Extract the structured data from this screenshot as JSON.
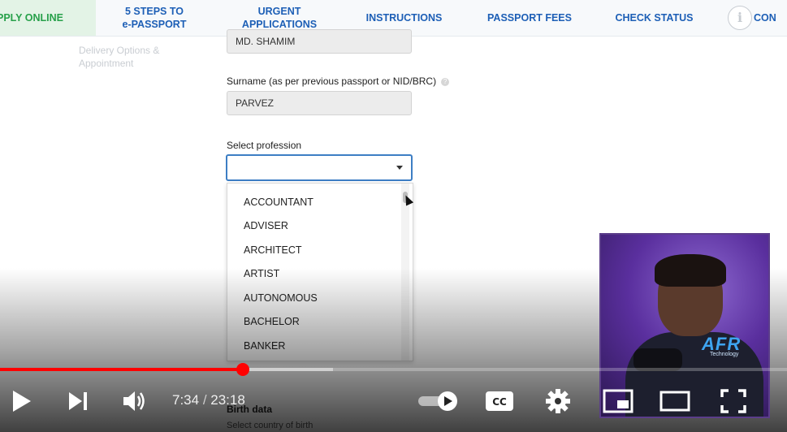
{
  "nav": {
    "apply_online": "PPLY ONLINE",
    "five_steps_line1": "5 STEPS TO",
    "five_steps_line2": "e-PASSPORT",
    "urgent_line1": "URGENT",
    "urgent_line2": "APPLICATIONS",
    "instructions": "INSTRUCTIONS",
    "passport_fees": "PASSPORT FEES",
    "check_status": "CHECK STATUS",
    "info_icon": "info-icon",
    "contact_partial": "CON"
  },
  "sidebar": {
    "step_label": "Delivery Options & Appointment"
  },
  "form": {
    "given_name_value": "MD. SHAMIM",
    "surname_label": "Surname (as per previous passport or NID/BRC)",
    "surname_value": "PARVEZ",
    "profession_label": "Select profession",
    "profession_value": "",
    "profession_options": [
      "ACCOUNTANT",
      "ADVISER",
      "ARCHITECT",
      "ARTIST",
      "AUTONOMOUS",
      "BACHELOR",
      "BANKER"
    ],
    "birth_label": "Birth data",
    "birth_sub": "Select country of birth"
  },
  "player": {
    "current_time": "7:34",
    "separator": " / ",
    "duration": "23:18",
    "progress_fraction": 0.309,
    "buffered_fraction": 0.423,
    "accent_color": "#ff0000",
    "autoplay_on": true,
    "icons": [
      "play-icon",
      "next-icon",
      "volume-icon",
      "autoplay-toggle",
      "captions-icon",
      "settings-icon",
      "miniplayer-icon",
      "theater-icon",
      "fullscreen-icon"
    ]
  },
  "cam": {
    "logo_text": "AFR",
    "logo_sub": "Technology"
  }
}
